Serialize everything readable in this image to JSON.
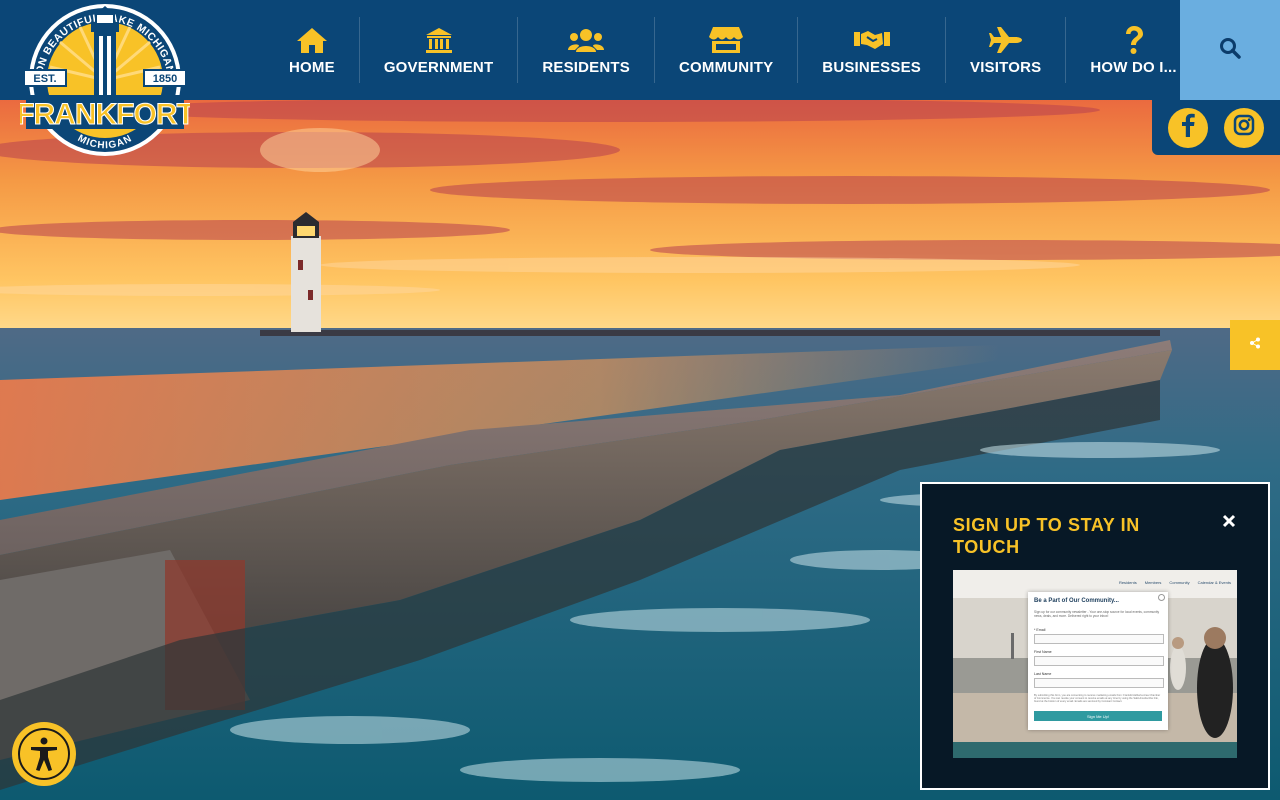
{
  "logo": {
    "top_text": "ON BEAUTIFUL LAKE MICHIGAN",
    "est_label": "EST.",
    "est_year": "1850",
    "name": "FRANKFORT",
    "subtitle": "MICHIGAN"
  },
  "nav": {
    "items": [
      {
        "label": "HOME",
        "icon": "home-icon"
      },
      {
        "label": "GOVERNMENT",
        "icon": "landmark-icon"
      },
      {
        "label": "RESIDENTS",
        "icon": "users-icon"
      },
      {
        "label": "COMMUNITY",
        "icon": "store-icon"
      },
      {
        "label": "BUSINESSES",
        "icon": "handshake-icon"
      },
      {
        "label": "VISITORS",
        "icon": "plane-icon"
      },
      {
        "label": "HOW DO I...",
        "icon": "question-icon"
      }
    ]
  },
  "search": {
    "icon": "search-icon"
  },
  "social": {
    "facebook_icon": "facebook-icon",
    "instagram_icon": "instagram-icon"
  },
  "share": {
    "icon": "share-icon"
  },
  "accessibility": {
    "icon": "accessibility-icon"
  },
  "popup": {
    "title": "SIGN UP TO STAY IN TOUCH",
    "close_icon": "close-icon",
    "preview": {
      "nav_links": [
        "Residents",
        "Members",
        "Community",
        "Calendar & Events"
      ],
      "form_title": "Be a Part of Our Community...",
      "form_desc": "Sign up for our community newsletter - Your one-stop source for local events, community news, deals, and more. Delivered right to your inbox!",
      "email_label": "* Email",
      "first_name_label": "First Name",
      "last_name_label": "Last Name",
      "fine_print": "By submitting this form, you are consenting to receive marketing emails from: Frankfort-Elberta Area Chamber of Commerce. You can revoke your consent to receive emails at any time by using the SafeUnsubscribe link, found at the bottom of every email. Emails are serviced by Constant Contact.",
      "submit_label": "Sign Me Up!"
    }
  },
  "colors": {
    "header": "#0b4677",
    "accent": "#f8c227",
    "search": "#6aaee0"
  }
}
